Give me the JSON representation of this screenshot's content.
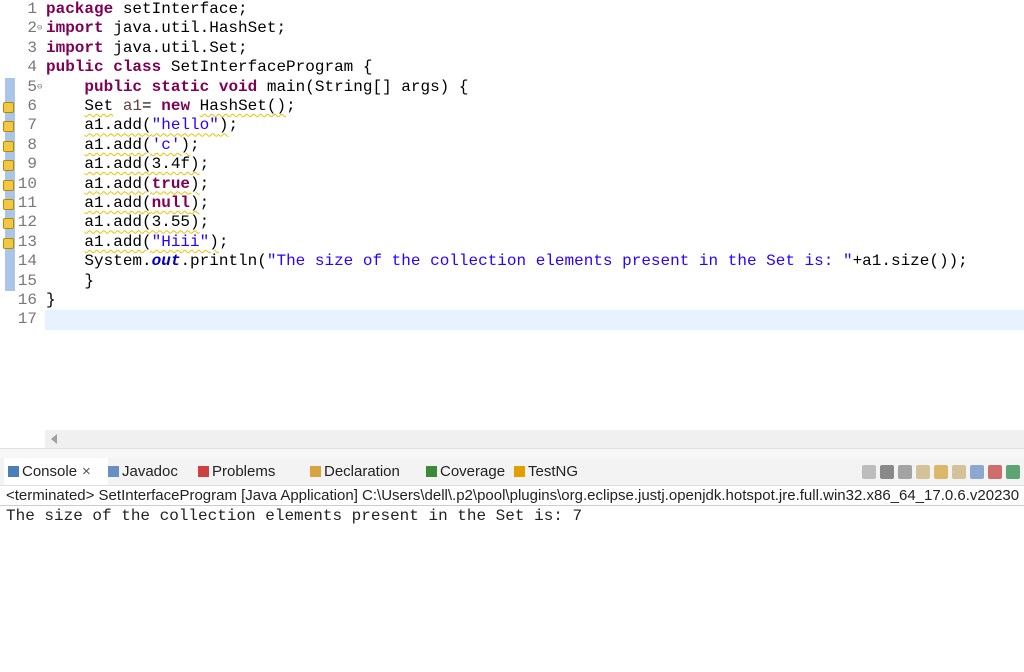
{
  "editor": {
    "lines": [
      {
        "n": "1",
        "t": [
          [
            "kw",
            "package"
          ],
          [
            "p",
            " setInterface;"
          ]
        ]
      },
      {
        "n": "2",
        "fold": true,
        "t": [
          [
            "kw",
            "import"
          ],
          [
            "p",
            " java.util.HashSet;"
          ]
        ]
      },
      {
        "n": "3",
        "t": [
          [
            "kw",
            "import"
          ],
          [
            "p",
            " java.util.Set;"
          ]
        ]
      },
      {
        "n": "4",
        "t": [
          [
            "kw",
            "public"
          ],
          [
            "p",
            " "
          ],
          [
            "kw",
            "class"
          ],
          [
            "p",
            " SetInterfaceProgram {"
          ]
        ]
      },
      {
        "n": "5",
        "fold": true,
        "mark": true,
        "t": [
          [
            "p",
            "    "
          ],
          [
            "kw",
            "public"
          ],
          [
            "p",
            " "
          ],
          [
            "kw",
            "static"
          ],
          [
            "p",
            " "
          ],
          [
            "kw",
            "void"
          ],
          [
            "p",
            " main(String[] args) {"
          ]
        ]
      },
      {
        "n": "6",
        "mark": true,
        "warn": true,
        "t": [
          [
            "p",
            "    "
          ],
          [
            "pw",
            "Set"
          ],
          [
            "p",
            " "
          ],
          [
            "var",
            "a1"
          ],
          [
            "p",
            "= "
          ],
          [
            "kw",
            "new"
          ],
          [
            "p",
            " "
          ],
          [
            "pw",
            "HashSet()"
          ],
          [
            "p",
            ";"
          ]
        ]
      },
      {
        "n": "7",
        "mark": true,
        "warn": true,
        "t": [
          [
            "p",
            "    "
          ],
          [
            "pw",
            "a1.add("
          ],
          [
            "sw",
            "\"hello\""
          ],
          [
            "pw",
            ")"
          ],
          [
            "p",
            ";"
          ]
        ]
      },
      {
        "n": "8",
        "mark": true,
        "warn": true,
        "t": [
          [
            "p",
            "    "
          ],
          [
            "pw",
            "a1.add("
          ],
          [
            "sw",
            "'c'"
          ],
          [
            "pw",
            ")"
          ],
          [
            "p",
            ";"
          ]
        ]
      },
      {
        "n": "9",
        "mark": true,
        "warn": true,
        "t": [
          [
            "p",
            "    "
          ],
          [
            "pw",
            "a1.add(3.4f)"
          ],
          [
            "p",
            ";"
          ]
        ]
      },
      {
        "n": "10",
        "mark": true,
        "warn": true,
        "t": [
          [
            "p",
            "    "
          ],
          [
            "pw",
            "a1.add("
          ],
          [
            "kww",
            "true"
          ],
          [
            "pw",
            ")"
          ],
          [
            "p",
            ";"
          ]
        ]
      },
      {
        "n": "11",
        "mark": true,
        "warn": true,
        "t": [
          [
            "p",
            "    "
          ],
          [
            "pw",
            "a1.add("
          ],
          [
            "kww",
            "null"
          ],
          [
            "pw",
            ")"
          ],
          [
            "p",
            ";"
          ]
        ]
      },
      {
        "n": "12",
        "mark": true,
        "warn": true,
        "t": [
          [
            "p",
            "    "
          ],
          [
            "pw",
            "a1.add(3.55)"
          ],
          [
            "p",
            ";"
          ]
        ]
      },
      {
        "n": "13",
        "mark": true,
        "warn": true,
        "t": [
          [
            "p",
            "    "
          ],
          [
            "pw",
            "a1.add("
          ],
          [
            "sw",
            "\"Hiii\""
          ],
          [
            "pw",
            ")"
          ],
          [
            "p",
            ";"
          ]
        ]
      },
      {
        "n": "14",
        "mark": true,
        "t": [
          [
            "p",
            "    System."
          ],
          [
            "fld",
            "out"
          ],
          [
            "p",
            ".println("
          ],
          [
            "str",
            "\"The size of the collection elements present in the Set is: \""
          ],
          [
            "p",
            "+a1.size());"
          ]
        ]
      },
      {
        "n": "15",
        "mark": true,
        "t": [
          [
            "p",
            "    }"
          ]
        ]
      },
      {
        "n": "16",
        "t": [
          [
            "p",
            "}"
          ]
        ]
      },
      {
        "n": "17",
        "current": true,
        "t": []
      }
    ]
  },
  "console": {
    "tabs": [
      {
        "label": "Console",
        "icon": "console-icon",
        "color": "#4a7ebb",
        "active": true,
        "close": "×"
      },
      {
        "label": "Javadoc",
        "icon": "javadoc-icon",
        "color": "#6a8fc4"
      },
      {
        "label": "Problems",
        "icon": "problems-icon",
        "color": "#d04040"
      },
      {
        "label": "Declaration",
        "icon": "declaration-icon",
        "color": "#d9a440"
      },
      {
        "label": "Coverage",
        "icon": "coverage-icon",
        "color": "#3a8a3a"
      },
      {
        "label": "TestNG",
        "icon": "testng-icon",
        "color": "#e0a000"
      }
    ],
    "tools": [
      "terminate-icon",
      "remove-launch-icon",
      "remove-all-terminated-icon",
      "clear-console-icon",
      "scroll-lock-icon",
      "word-wrap-icon",
      "show-on-stdout-icon",
      "show-on-stderr-icon",
      "open-console-icon"
    ],
    "status": "<terminated> SetInterfaceProgram [Java Application] C:\\Users\\dell\\.p2\\pool\\plugins\\org.eclipse.justj.openjdk.hotspot.jre.full.win32.x86_64_17.0.6.v20230",
    "output": "The size of the collection elements present in the Set is: 7"
  }
}
